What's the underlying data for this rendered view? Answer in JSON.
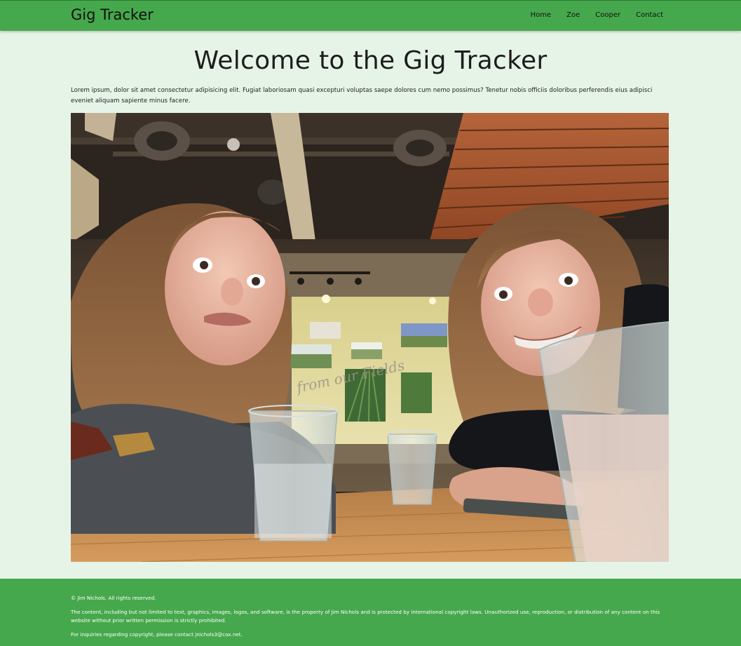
{
  "header": {
    "brand": "Gig Tracker",
    "nav": [
      "Home",
      "Zoe",
      "Cooper",
      "Contact"
    ]
  },
  "main": {
    "title": "Welcome to the Gig Tracker",
    "intro": "Lorem ipsum, dolor sit amet consectetur adipisicing elit. Fugiat laboriosam quasi excepturi voluptas saepe dolores cum nemo possimus? Tenetur nobis officiis doloribus perferendis eius adipisci eveniet aliquam sapiente minus facere.",
    "photo_sign_text": "from our Fields"
  },
  "footer": {
    "copyright": "© Jim Nichols. All rights reserved.",
    "notice": "The content, including but not limited to text, graphics, images, logos, and software, is the property of Jim Nichols and is protected by international copyright laws. Unauthorized use, reproduction, or distribution of any content on this website without prior written permission is strictly prohibited.",
    "contact": "For inquiries regarding copyright, please contact jnichols3@cox.net."
  },
  "colors": {
    "nav_green": "#46a84c",
    "page_background": "#e6f4e8",
    "footer_green": "#46a84c"
  }
}
